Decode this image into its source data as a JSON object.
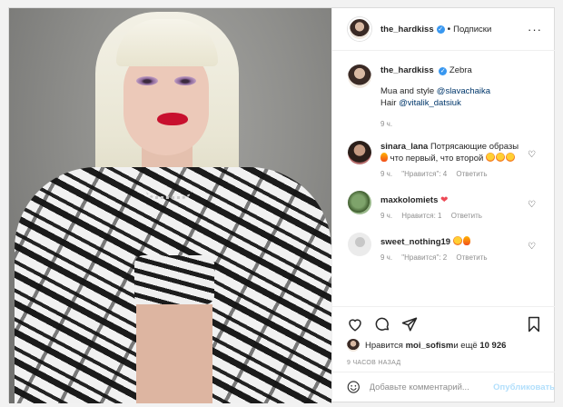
{
  "header": {
    "username": "the_hardkiss",
    "separator": "•",
    "follow_label": "Подписки",
    "more_label": "···"
  },
  "caption": {
    "username": "the_hardkiss",
    "text_1": "Zebra",
    "line_2_prefix": "Mua and style ",
    "line_2_mention": "@slavachaika",
    "line_3_prefix": "Hair ",
    "line_3_mention": "@vitalik_datsiuk",
    "time": "9 ч."
  },
  "comments": [
    {
      "username": "sinara_lana",
      "text": "Потрясающие образы",
      "text_2": "что первый, что второй",
      "time": "9 ч.",
      "likes": "\"Нравится\": 4",
      "reply": "Ответить"
    },
    {
      "username": "maxkolomiets",
      "text": "❤",
      "time": "9 ч.",
      "likes": "Нравится: 1",
      "reply": "Ответить"
    },
    {
      "username": "sweet_nothing19",
      "time": "9 ч.",
      "likes": "\"Нравится\": 2",
      "reply": "Ответить"
    }
  ],
  "likes": {
    "prefix": "Нравится ",
    "user": "moi_sofism",
    "middle": " и ещё ",
    "count": "10 926"
  },
  "post_time": "9 ЧАСОВ НАЗАД",
  "add_comment": {
    "placeholder": "Добавьте комментарий...",
    "publish_label": "Опубликовать"
  },
  "colors": {
    "link": "#00376b",
    "verified": "#3897f0",
    "publish_disabled": "#b2dffc",
    "heart_red": "#ed4956"
  },
  "icons": [
    "verified-icon",
    "more-icon",
    "heart-icon",
    "comment-icon",
    "share-icon",
    "bookmark-icon",
    "emoji-icon"
  ]
}
